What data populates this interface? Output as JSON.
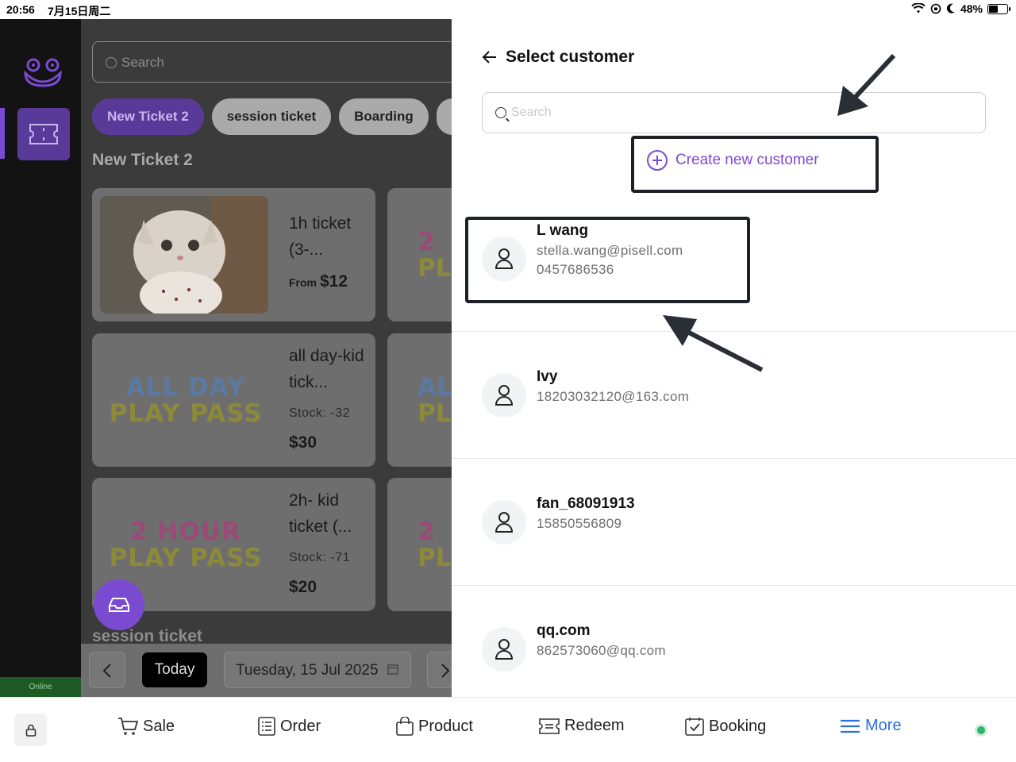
{
  "status_bar": {
    "time": "20:56",
    "date": "7月15日周二",
    "battery": "48%"
  },
  "sidebar": {
    "online_label": "Online"
  },
  "main": {
    "search_placeholder": "Search",
    "chips": [
      "New Ticket 2",
      "session ticket",
      "Boarding"
    ],
    "section_title": "New Ticket 2",
    "section2_title": "session ticket",
    "cards": [
      {
        "name": "1h ticket (3-...",
        "from_label": "From",
        "price": "$12"
      },
      {
        "name": "all day-kid tick...",
        "art_line1": "ALL DAY",
        "art_line2": "PLAY PASS",
        "stock": "Stock: -32",
        "price": "$30"
      },
      {
        "name": "2h- kid ticket (...",
        "art_line1": "2 HOUR",
        "art_line2": "PLAY PASS",
        "stock": "Stock: -71",
        "price": "$20"
      }
    ],
    "partial_cards": [
      {
        "l1": "2",
        "l2": "PL"
      },
      {
        "l1": "AL",
        "l2": "PL"
      },
      {
        "l1": "2",
        "l2": "PL"
      }
    ],
    "date_bar": {
      "today_label": "Today",
      "date_label": "Tuesday, 15 Jul 2025"
    }
  },
  "panel": {
    "title": "Select customer",
    "search_placeholder": "Search",
    "create_label": "Create new customer",
    "customers": [
      {
        "name": "L wang",
        "email": "stella.wang@pisell.com",
        "phone": "0457686536"
      },
      {
        "name": "Ivy",
        "email": "18203032120@163.com",
        "phone": ""
      },
      {
        "name": "fan_68091913",
        "email": "15850556809",
        "phone": ""
      },
      {
        "name": "qq.com",
        "email": "862573060@qq.com",
        "phone": ""
      }
    ]
  },
  "tabbar": {
    "items": [
      {
        "label": "Sale",
        "icon": "cart-icon"
      },
      {
        "label": "Order",
        "icon": "list-icon"
      },
      {
        "label": "Product",
        "icon": "bag-icon"
      },
      {
        "label": "Redeem",
        "icon": "ticket-icon"
      },
      {
        "label": "Booking",
        "icon": "calendar-check-icon"
      },
      {
        "label": "More",
        "icon": "menu-icon"
      }
    ]
  },
  "colors": {
    "accent": "#7a4bd1",
    "more": "#2a6fe0",
    "online": "#2fb36b"
  }
}
